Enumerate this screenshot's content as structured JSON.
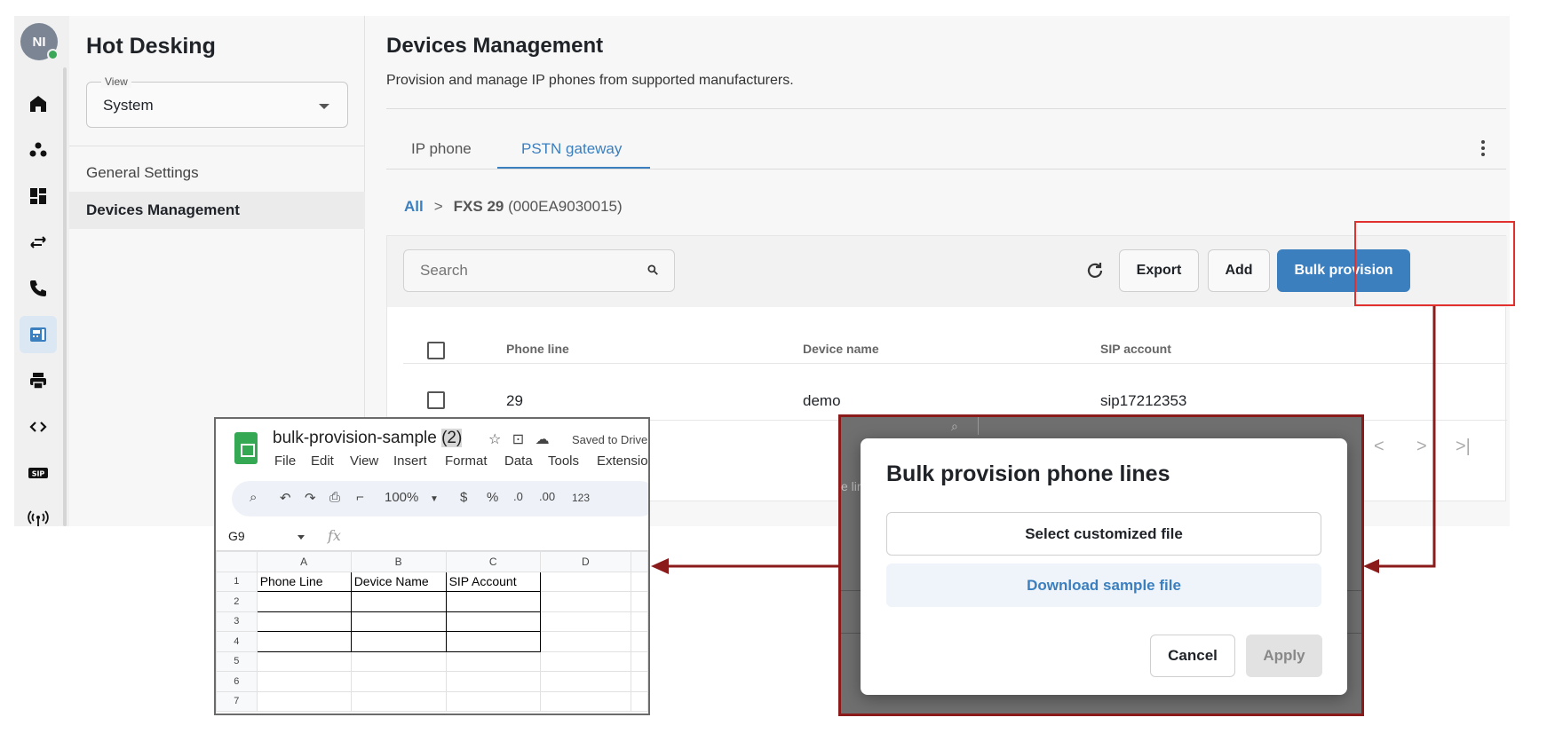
{
  "user": {
    "initials": "NI"
  },
  "rail": {
    "items": [
      {
        "icon": "home-icon"
      },
      {
        "icon": "users-icon"
      },
      {
        "icon": "dashboard-icon"
      },
      {
        "icon": "transfer-icon"
      },
      {
        "icon": "call-icon"
      },
      {
        "icon": "desk-phone-icon",
        "active": true
      },
      {
        "icon": "printer-icon"
      },
      {
        "icon": "code-icon"
      },
      {
        "icon": "sip-icon",
        "label": "SIP"
      },
      {
        "icon": "antenna-icon"
      }
    ]
  },
  "sidebar": {
    "title": "Hot Desking",
    "view": {
      "label": "View",
      "value": "System"
    },
    "items": [
      {
        "label": "General Settings"
      },
      {
        "label": "Devices Management",
        "active": true
      }
    ]
  },
  "main": {
    "title": "Devices Management",
    "subtitle": "Provision and manage IP phones from supported manufacturers.",
    "tabs": [
      {
        "label": "IP phone"
      },
      {
        "label": "PSTN gateway",
        "active": true
      }
    ],
    "breadcrumb": {
      "root": "All",
      "current": "FXS 29",
      "id": "(000EA9030015)"
    },
    "search": {
      "placeholder": "Search"
    },
    "toolbar": {
      "export": "Export",
      "add": "Add",
      "bulk": "Bulk provision"
    },
    "table": {
      "columns": [
        "Phone line",
        "Device name",
        "SIP account"
      ],
      "rows": [
        {
          "phone_line": "29",
          "device_name": "demo",
          "sip_account": "sip17212353"
        }
      ]
    }
  },
  "sheet": {
    "title_main": "bulk-provision-sample ",
    "title_highlight": "(2)",
    "saved": "Saved to Drive",
    "menu": [
      "File",
      "Edit",
      "View",
      "Insert",
      "Format",
      "Data",
      "Tools",
      "Extensio"
    ],
    "zoom": "100%",
    "toolbar_text": {
      "dollar": "$",
      "percent": "%",
      "dec_less": ".0",
      "dec_more": ".00",
      "num": "123"
    },
    "namebox": "G9",
    "fx": "fx",
    "columns": [
      "A",
      "B",
      "C",
      "D"
    ],
    "rows": [
      "1",
      "2",
      "3",
      "4",
      "5",
      "6",
      "7"
    ],
    "headers": [
      "Phone Line",
      "Device Name",
      "SIP Account"
    ]
  },
  "modal": {
    "title": "Bulk provision phone lines",
    "select_file": "Select customized file",
    "download_sample": "Download sample file",
    "cancel": "Cancel",
    "apply": "Apply",
    "bg_fragment": "e lir"
  },
  "colors": {
    "accent": "#3b7fbf",
    "highlight_box": "#e0312f",
    "arrow": "#8b1a1a"
  }
}
